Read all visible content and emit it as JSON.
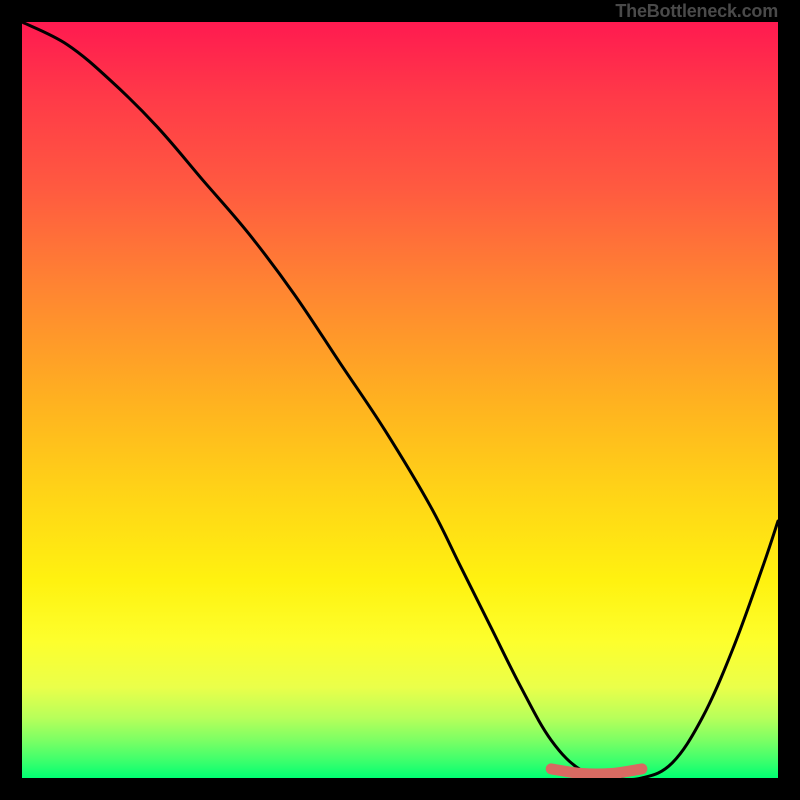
{
  "watermark": "TheBottleneck.com",
  "chart_data": {
    "type": "line",
    "title": "",
    "xlabel": "",
    "ylabel": "",
    "xlim": [
      0,
      100
    ],
    "ylim": [
      0,
      100
    ],
    "grid": false,
    "legend": false,
    "series": [
      {
        "name": "bottleneck-curve",
        "color": "#000000",
        "x": [
          0,
          6,
          12,
          18,
          24,
          30,
          36,
          42,
          48,
          54,
          58,
          62,
          66,
          70,
          74,
          78,
          82,
          86,
          90,
          94,
          98,
          100
        ],
        "y": [
          100,
          97,
          92,
          86,
          79,
          72,
          64,
          55,
          46,
          36,
          28,
          20,
          12,
          5,
          1,
          0,
          0,
          2,
          8,
          17,
          28,
          34
        ]
      },
      {
        "name": "optimal-band-marker",
        "color": "#d86a62",
        "x": [
          70,
          74,
          78,
          82
        ],
        "y": [
          1.2,
          0.6,
          0.6,
          1.2
        ]
      }
    ],
    "background_gradient": {
      "top_color": "#ff1a50",
      "bottom_color": "#00ff72",
      "description": "vertical red-to-yellow-to-green gradient"
    }
  }
}
